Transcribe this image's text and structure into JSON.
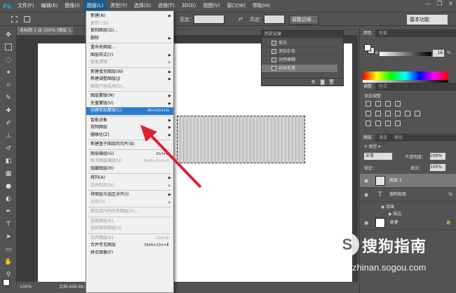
{
  "app": {
    "logo": "Ps"
  },
  "menubar": {
    "items": [
      "文件(F)",
      "编辑(E)",
      "图像(I)",
      "图层(L)",
      "类型(Y)",
      "选择(S)",
      "滤镜(T)",
      "3D(D)",
      "视图(V)",
      "窗口(W)",
      "帮助(H)"
    ],
    "active_index": 3
  },
  "window_controls": {
    "minimize": "—",
    "restore": "❐",
    "close": "✕"
  },
  "options_bar": {
    "width_label": "宽度：",
    "height_label": "高度：",
    "refine_edge": "调整边缘...",
    "workspace": "基本功能"
  },
  "doc_tab": {
    "title": "未标题-1 @ 100% (图层 1, RGB/8)"
  },
  "layer_menu": {
    "items": [
      {
        "label": "新建(N)",
        "arrow": true
      },
      {
        "label": "复制 CSS",
        "disabled": true
      },
      {
        "label": "复制图层(D)..."
      },
      {
        "label": "删除",
        "arrow": true
      },
      {
        "sep": true
      },
      {
        "label": "重命名图层..."
      },
      {
        "label": "图层样式(Y)",
        "arrow": true
      },
      {
        "label": "智能滤镜",
        "disabled": true,
        "arrow": true
      },
      {
        "sep": true
      },
      {
        "label": "新建填充图层(W)",
        "arrow": true
      },
      {
        "label": "新建调整图层(J)",
        "arrow": true
      },
      {
        "label": "图层内容选项(O)...",
        "disabled": true
      },
      {
        "sep": true
      },
      {
        "label": "图层蒙版(M)",
        "arrow": true
      },
      {
        "label": "矢量蒙版(V)",
        "arrow": true
      },
      {
        "label": "创建剪贴蒙版(C)",
        "shortcut": "Alt+Ctrl+G",
        "highlighted": true
      },
      {
        "sep": true
      },
      {
        "label": "智能对象",
        "arrow": true
      },
      {
        "label": "视频图层",
        "arrow": true
      },
      {
        "label": "栅格化(Z)",
        "arrow": true
      },
      {
        "sep": true
      },
      {
        "label": "新建基于图层的切片(B)"
      },
      {
        "sep": true
      },
      {
        "label": "图层编组(G)",
        "shortcut": "Ctrl+G"
      },
      {
        "label": "取消图层编组(U)",
        "shortcut": "Shift+Ctrl+G",
        "disabled": true
      },
      {
        "label": "隐藏图层(R)"
      },
      {
        "sep": true
      },
      {
        "label": "排列(A)",
        "arrow": true
      },
      {
        "label": "合并形状(H)",
        "disabled": true,
        "arrow": true
      },
      {
        "sep": true
      },
      {
        "label": "将图层与选区对齐(I)",
        "arrow": true
      },
      {
        "label": "分布(T)",
        "disabled": true,
        "arrow": true
      },
      {
        "sep": true
      },
      {
        "label": "锁定组内的所有图层(X)...",
        "disabled": true
      },
      {
        "sep": true
      },
      {
        "label": "链接图层(K)",
        "disabled": true
      },
      {
        "label": "选择链接图层(S)",
        "disabled": true
      },
      {
        "sep": true
      },
      {
        "label": "合并图层(E)",
        "shortcut": "Ctrl+E",
        "disabled": true
      },
      {
        "label": "合并可见图层",
        "shortcut": "Shift+Ctrl+E"
      },
      {
        "label": "拼合图像(F)"
      }
    ]
  },
  "history": {
    "title": "历史记录",
    "items": [
      "填充",
      "添加杂色",
      "动感模糊",
      "自由变换"
    ],
    "selected_index": 3
  },
  "color_panel": {
    "tabs": [
      "颜色",
      "色板"
    ],
    "k_label": "K",
    "k_value": "16",
    "k_unit": "%"
  },
  "adjustments_panel": {
    "tabs": [
      "调整",
      "样式"
    ],
    "title": "添加调整"
  },
  "layers_panel": {
    "tabs": [
      "图层",
      "通道",
      "路径"
    ],
    "filter": "类型",
    "blend_mode": "正常",
    "opacity_label": "不透明度：",
    "opacity": "100%",
    "lock_label": "锁定：",
    "fill_label": "填充：",
    "fill": "100%",
    "layers": [
      {
        "name": "图层 1",
        "selected": true
      },
      {
        "name": "搜狗指南",
        "type": "text",
        "fx": true
      },
      {
        "name": "效果",
        "sub": true
      },
      {
        "name": "描边",
        "sub": true
      },
      {
        "name": "背景",
        "locked": true
      }
    ]
  },
  "status": {
    "zoom": "100%",
    "doc": "文档:468.8K/..."
  },
  "watermark": {
    "logo": "S",
    "name": "搜狗指南",
    "url": "zhinan.sogou.com"
  },
  "colors": {
    "accent": "#2a7bd0",
    "panel": "#535353",
    "arrow": "#e02030"
  }
}
